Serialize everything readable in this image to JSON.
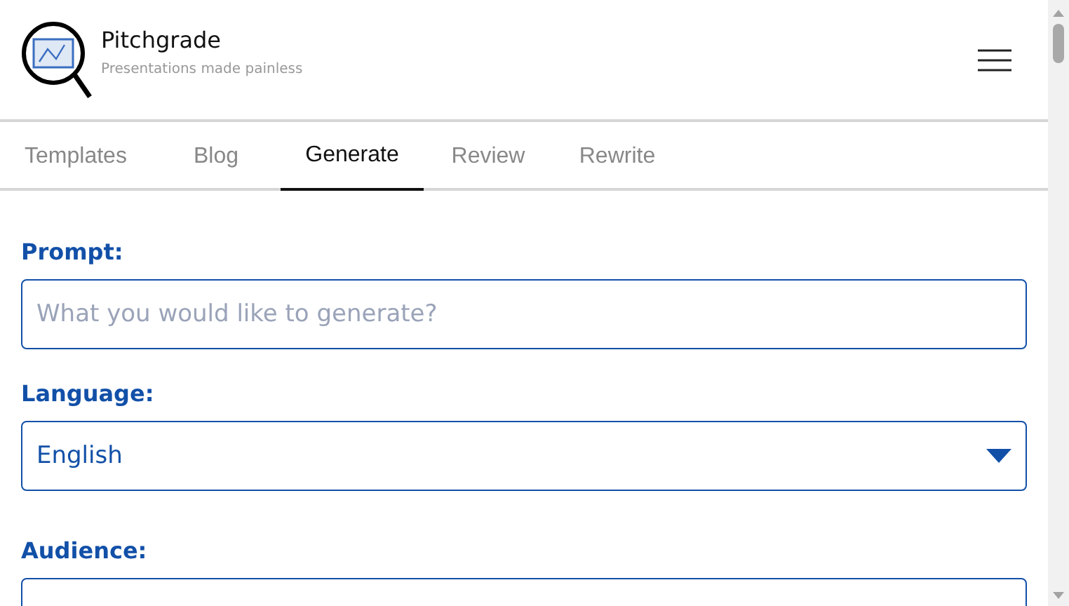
{
  "brand": {
    "name": "Pitchgrade",
    "tagline": "Presentations made painless"
  },
  "tabs": [
    {
      "label": "Templates",
      "selected": false
    },
    {
      "label": "Blog",
      "selected": false
    },
    {
      "label": "Generate",
      "selected": true
    },
    {
      "label": "Review",
      "selected": false
    },
    {
      "label": "Rewrite",
      "selected": false
    }
  ],
  "form": [
    {
      "kind": "text",
      "label": "Prompt:",
      "placeholder": "What you would like to generate?"
    },
    {
      "kind": "select",
      "label": "Language:",
      "value": "English"
    },
    {
      "kind": "text",
      "label": "Audience:"
    }
  ]
}
